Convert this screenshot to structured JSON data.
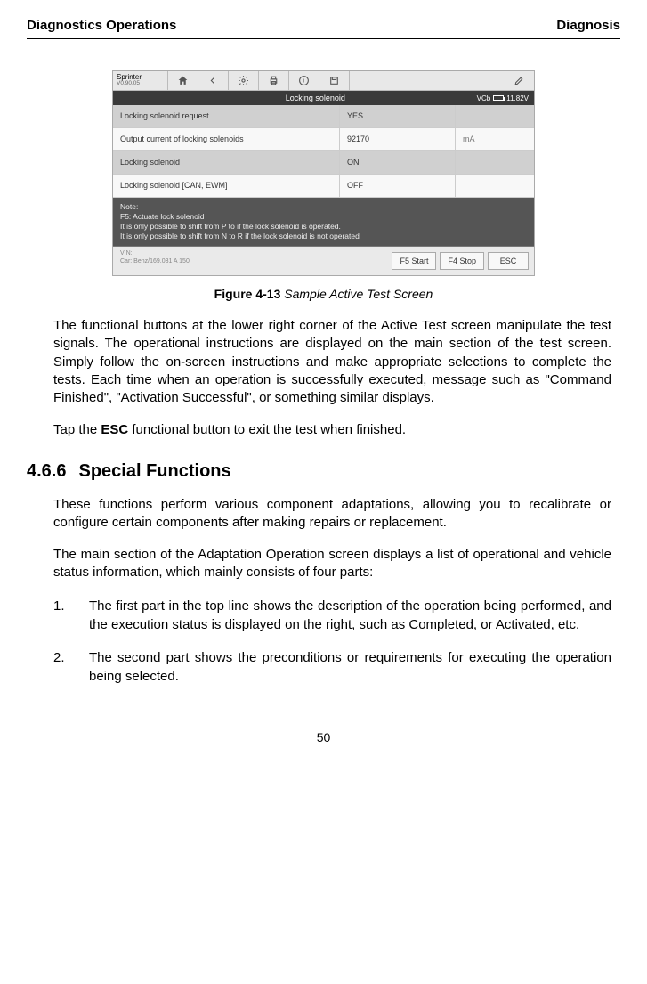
{
  "header": {
    "left": "Diagnostics Operations",
    "right": "Diagnosis"
  },
  "screenshot": {
    "appName": "Sprinter",
    "appVersion": "V0.90.05",
    "titleBar": "Locking solenoid",
    "batteryLabel": "VCb",
    "batteryValue": "11.82V",
    "rows": [
      {
        "label": "Locking solenoid request",
        "value": "YES",
        "unit": ""
      },
      {
        "label": "Output current of locking solenoids",
        "value": "92170",
        "unit": "mA"
      },
      {
        "label": "Locking solenoid",
        "value": "ON",
        "unit": ""
      },
      {
        "label": "Locking solenoid [CAN, EWM]",
        "value": "OFF",
        "unit": ""
      }
    ],
    "note": "Note:\nF5: Actuate lock solenoid\nIt is only possible to shift from P to if the lock solenoid is operated.\nIt is only possible to shift from N to R if the lock solenoid is not operated",
    "vinLabel": "VIN:",
    "vinValue": "Car: Benz/169.031 A 150",
    "buttons": {
      "f5": "F5 Start",
      "f4": "F4 Stop",
      "esc": "ESC"
    }
  },
  "figure": {
    "label": "Figure 4-13",
    "title": " Sample Active Test Screen"
  },
  "paragraphs": {
    "p1": "The functional buttons at the lower right corner of the Active Test screen manipulate the test signals. The operational instructions are displayed on the main section of the test screen. Simply follow the on-screen instructions and make appropriate selections to complete the tests. Each time when an operation is successfully executed, message such as \"Command Finished\", \"Activation Successful\", or something similar displays.",
    "p2a": "Tap the ",
    "p2b": "ESC",
    "p2c": " functional button to exit the test when finished.",
    "p3": "These functions perform various component adaptations, allowing you to recalibrate or configure certain components after making repairs or replacement.",
    "p4": "The main section of the Adaptation Operation screen displays a list of operational and vehicle status information, which mainly consists of four parts:"
  },
  "section": {
    "num": "4.6.6",
    "title": "Special Functions"
  },
  "list": {
    "item1": {
      "num": "1.",
      "text": "The first part in the top line shows the description of the operation being performed, and the execution status is displayed on the right, such as Completed, or Activated, etc."
    },
    "item2": {
      "num": "2.",
      "text": "The second part shows the preconditions or requirements for executing the operation being selected."
    }
  },
  "pageNumber": "50"
}
